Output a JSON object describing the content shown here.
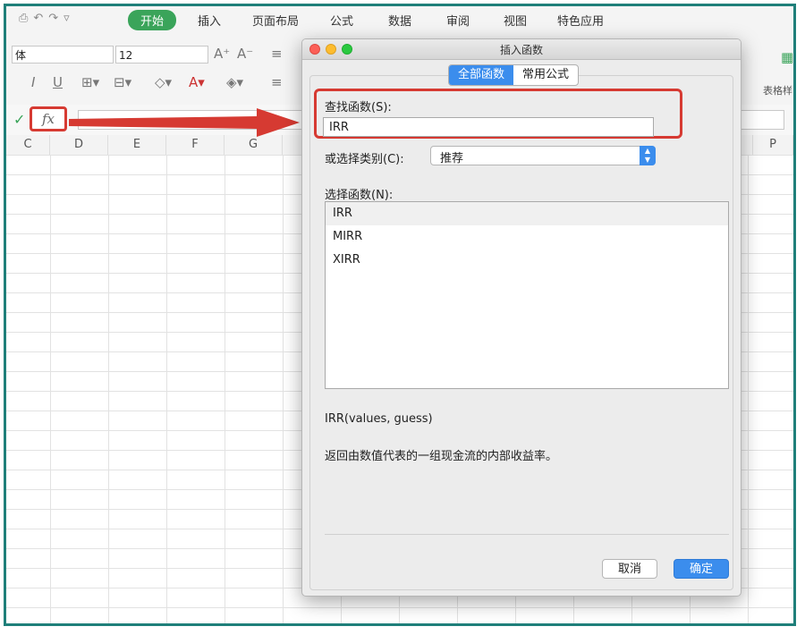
{
  "ribbon": {
    "tabs": [
      {
        "label": "开始",
        "active": true
      },
      {
        "label": "插入"
      },
      {
        "label": "页面布局"
      },
      {
        "label": "公式"
      },
      {
        "label": "数据"
      },
      {
        "label": "审阅"
      },
      {
        "label": "视图"
      },
      {
        "label": "特色应用"
      }
    ],
    "font_name": "体",
    "font_size": "12",
    "table_style_label": "表格样"
  },
  "formula_bar": {
    "fx_label": "fx"
  },
  "sheet": {
    "columns": [
      "C",
      "D",
      "E",
      "F",
      "G",
      "P"
    ]
  },
  "dialog": {
    "title": "插入函数",
    "tabs": [
      {
        "label": "全部函数",
        "active": true
      },
      {
        "label": "常用公式"
      }
    ],
    "search_label": "查找函数(S):",
    "search_value": "IRR",
    "category_label": "或选择类别(C):",
    "category_value": "推荐",
    "list_label": "选择函数(N):",
    "functions": [
      "IRR",
      "MIRR",
      "XIRR"
    ],
    "selected_function": "IRR",
    "signature": "IRR(values, guess)",
    "description": "返回由数值代表的一组现金流的内部收益率。",
    "cancel_label": "取消",
    "ok_label": "确定"
  },
  "colors": {
    "accent_green": "#3aa45a",
    "highlight_red": "#d63a32",
    "mac_blue": "#3b8ded",
    "frame_teal": "#1f7f7a"
  }
}
